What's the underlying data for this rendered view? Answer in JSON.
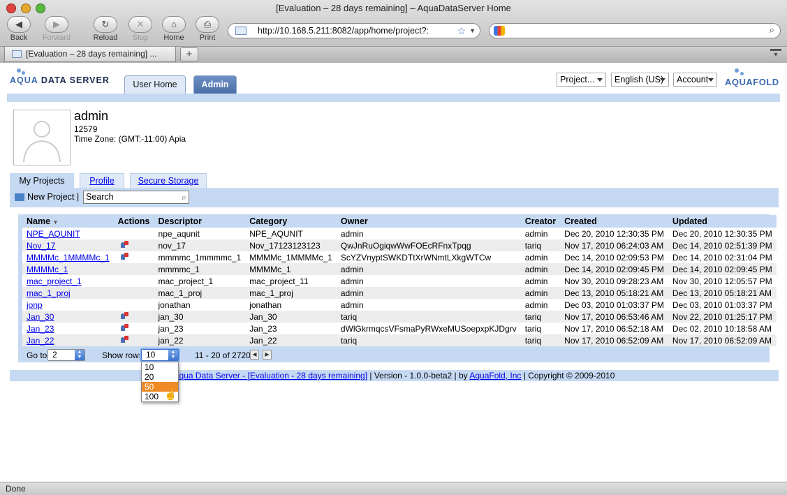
{
  "window": {
    "title": "[Evaluation – 28 days remaining] – AquaDataServer Home",
    "tab_title": "[Evaluation – 28 days remaining] ...",
    "url": "http://10.168.5.211:8082/app/home/project?:",
    "status": "Done"
  },
  "nav": {
    "back": "Back",
    "forward": "Forward",
    "reload": "Reload",
    "stop": "Stop",
    "home": "Home",
    "print": "Print"
  },
  "header": {
    "logo_left_a": "AQUA",
    "logo_left_b": " DATA SERVER",
    "logo_right": "AQUAFOLD",
    "tab_user_home": "User Home",
    "tab_admin": "Admin",
    "project_select": "Project...",
    "language_select": "English (US)",
    "account_select": "Account"
  },
  "user": {
    "name": "admin",
    "id": "12579",
    "timezone": "Time Zone: (GMT:-11:00) Apia"
  },
  "subtabs": {
    "projects": "My Projects",
    "profile": "Profile",
    "secure": "Secure Storage"
  },
  "toolbar": {
    "new_project": "New Project",
    "separator": "|",
    "search_value": "Search"
  },
  "grid": {
    "columns": [
      "Name",
      "Actions",
      "Descriptor",
      "Category",
      "Owner",
      "Creator",
      "Created",
      "Updated"
    ],
    "rows": [
      {
        "name": "NPE_AQUNIT",
        "shared": false,
        "descriptor": "npe_aqunit",
        "category": "NPE_AQUNIT",
        "owner": "admin",
        "creator": "admin",
        "created": "Dec 20, 2010 12:30:35 PM",
        "updated": "Dec 20, 2010 12:30:35 PM"
      },
      {
        "name": "Nov_17",
        "shared": true,
        "descriptor": "nov_17",
        "category": "Nov_17123123123",
        "owner": "QwJnRuOgiqwWwFOEcRFnxTpqg",
        "creator": "tariq",
        "created": "Nov 17, 2010 06:24:03 AM",
        "updated": "Dec 14, 2010 02:51:39 PM"
      },
      {
        "name": "MMMMc_1MMMMc_1",
        "shared": true,
        "descriptor": "mmmmc_1mmmmc_1",
        "category": "MMMMc_1MMMMc_1",
        "owner": "ScYZVnyptSWKDTtXrWNmtLXkgWTCw",
        "creator": "admin",
        "created": "Dec 14, 2010 02:09:53 PM",
        "updated": "Dec 14, 2010 02:31:04 PM"
      },
      {
        "name": "MMMMc_1",
        "shared": false,
        "descriptor": "mmmmc_1",
        "category": "MMMMc_1",
        "owner": "admin",
        "creator": "admin",
        "created": "Dec 14, 2010 02:09:45 PM",
        "updated": "Dec 14, 2010 02:09:45 PM"
      },
      {
        "name": "mac_project_1",
        "shared": false,
        "descriptor": "mac_project_1",
        "category": "mac_project_11",
        "owner": "admin",
        "creator": "admin",
        "created": "Nov 30, 2010 09:28:23 AM",
        "updated": "Nov 30, 2010 12:05:57 PM"
      },
      {
        "name": "mac_1_proj",
        "shared": false,
        "descriptor": "mac_1_proj",
        "category": "mac_1_proj",
        "owner": "admin",
        "creator": "admin",
        "created": "Dec 13, 2010 05:18:21 AM",
        "updated": "Dec 13, 2010 05:18:21 AM"
      },
      {
        "name": "jonp",
        "shared": false,
        "descriptor": "jonathan",
        "category": "jonathan",
        "owner": "admin",
        "creator": "admin",
        "created": "Dec 03, 2010 01:03:37 PM",
        "updated": "Dec 03, 2010 01:03:37 PM"
      },
      {
        "name": "Jan_30",
        "shared": true,
        "descriptor": "jan_30",
        "category": "Jan_30",
        "owner": "tariq",
        "creator": "tariq",
        "created": "Nov 17, 2010 06:53:46 AM",
        "updated": "Nov 22, 2010 01:25:17 PM"
      },
      {
        "name": "Jan_23",
        "shared": true,
        "descriptor": "jan_23",
        "category": "Jan_23",
        "owner": "dWlGkrmqcsVFsmaPyRWxeMUSoepxpKJDgrv",
        "creator": "tariq",
        "created": "Nov 17, 2010 06:52:18 AM",
        "updated": "Dec 02, 2010 10:18:58 AM"
      },
      {
        "name": "Jan_22",
        "shared": true,
        "descriptor": "jan_22",
        "category": "Jan_22",
        "owner": "tariq",
        "creator": "tariq",
        "created": "Nov 17, 2010 06:52:09 AM",
        "updated": "Nov 17, 2010 06:52:09 AM"
      }
    ]
  },
  "pager": {
    "goto_label": "Go to",
    "goto_value": "2",
    "showrows_label": "Show rows",
    "showrows_value": "10",
    "range": "11 - 20 of 2720",
    "options": [
      "10",
      "20",
      "50",
      "100"
    ],
    "highlighted_option": "50"
  },
  "footer": {
    "product_link": "Aqua Data Server - [Evaluation - 28 days remaining]",
    "version": " | Version - 1.0.0-beta2 | by ",
    "company_link": "AquaFold, Inc",
    "copyright": " | Copyright © 2009-2010"
  },
  "colors": {
    "accent_bar": "#c6d9f2",
    "dropdown_highlight": "#f08a24",
    "link": "#0000ee"
  }
}
